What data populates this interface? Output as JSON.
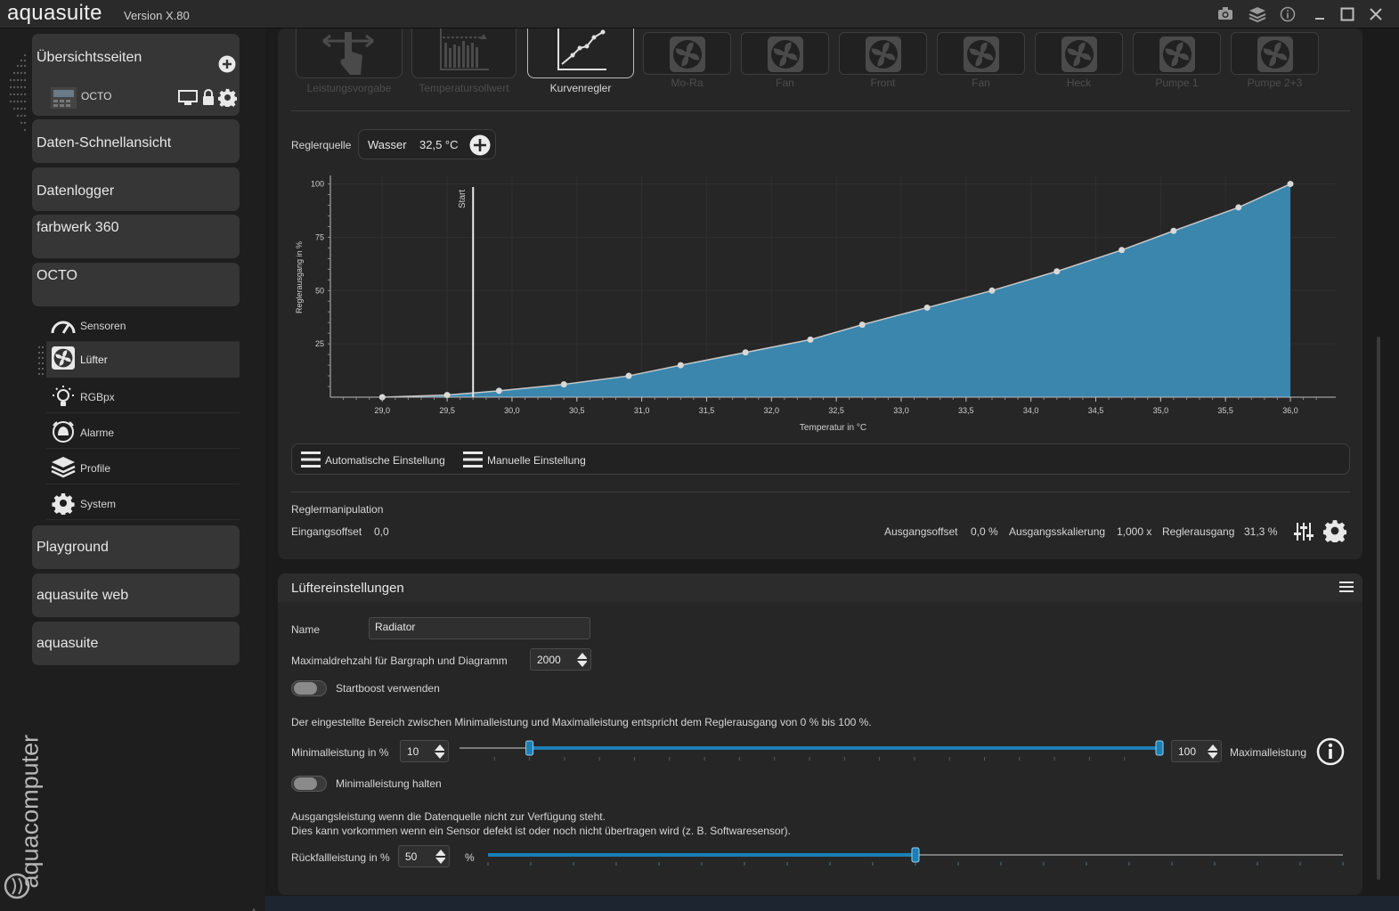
{
  "app": {
    "logo": "aquasuite",
    "version": "Version X.80",
    "vertical_brand": "aquacomputer"
  },
  "sidebar": {
    "overview": {
      "title": "Übersichtsseiten",
      "device": "OCTO"
    },
    "cards": [
      {
        "label": "Daten-Schnellansicht"
      },
      {
        "label": "Datenlogger"
      },
      {
        "label": "farbwerk 360"
      },
      {
        "label": "OCTO"
      }
    ],
    "sub_items": [
      {
        "label": "Sensoren",
        "icon": "gauge-icon"
      },
      {
        "label": "Lüfter",
        "icon": "fan-icon",
        "active": true
      },
      {
        "label": "RGBpx",
        "icon": "bulb-icon"
      },
      {
        "label": "Alarme",
        "icon": "alarm-icon"
      },
      {
        "label": "Profile",
        "icon": "layers-icon"
      },
      {
        "label": "System",
        "icon": "gear-icon"
      }
    ],
    "bottom_cards": [
      {
        "label": "Playground"
      },
      {
        "label": "aquasuite web"
      },
      {
        "label": "aquasuite"
      }
    ]
  },
  "controller": {
    "modes": [
      {
        "label": "Leistungsvorgabe",
        "state": "inactive"
      },
      {
        "label": "Temperatursollwert",
        "state": "inactive"
      },
      {
        "label": "Kurvenregler",
        "state": "active"
      }
    ],
    "fan_tiles": [
      {
        "label": "Mo-Ra"
      },
      {
        "label": "Fan"
      },
      {
        "label": "Front"
      },
      {
        "label": "Fan"
      },
      {
        "label": "Heck"
      },
      {
        "label": "Pumpe  1"
      },
      {
        "label": "Pumpe 2+3"
      }
    ],
    "source_label": "Reglerquelle",
    "source_name": "Wasser",
    "source_value": "32,5 °C",
    "auto_button": "Automatische Einstellung",
    "manual_button": "Manuelle Einstellung",
    "manipulation_label": "Reglermanipulation",
    "input_offset_label": "Eingangsoffset",
    "input_offset_value": "0,0",
    "output_offset_label": "Ausgangsoffset",
    "output_offset_value": "0,0 %",
    "output_scale_label": "Ausgangsskalierung",
    "output_scale_value": "1,000 x",
    "controller_output_label": "Reglerausgang",
    "controller_output_value": "31,3 %"
  },
  "chart_data": {
    "type": "area",
    "xlabel": "Temperatur in °C",
    "ylabel": "Reglerausgang in %",
    "xlim": [
      28.6,
      36.35
    ],
    "ylim": [
      0,
      104
    ],
    "x_ticks": [
      "29,0",
      "29,5",
      "30,0",
      "30,5",
      "31,0",
      "31,5",
      "32,0",
      "32,5",
      "33,0",
      "33,5",
      "34,0",
      "34,5",
      "35,0",
      "35,5",
      "36,0"
    ],
    "x_tick_values": [
      29.0,
      29.5,
      30.0,
      30.5,
      31.0,
      31.5,
      32.0,
      32.5,
      33.0,
      33.5,
      34.0,
      34.5,
      35.0,
      35.5,
      36.0
    ],
    "y_ticks": [
      "25",
      "50",
      "75",
      "100"
    ],
    "y_tick_values": [
      25,
      50,
      75,
      100
    ],
    "start_marker": {
      "label": "Start",
      "x": 29.7
    },
    "fill_color": "#3a86ad",
    "series": [
      {
        "x": [
          29.0,
          29.5,
          29.9,
          30.4,
          30.9,
          31.3,
          31.8,
          32.3,
          32.7,
          33.2,
          33.7,
          34.2,
          34.7,
          35.1,
          35.6,
          36.0
        ],
        "values": [
          0,
          1,
          3,
          6,
          10,
          15,
          21,
          27,
          34,
          42,
          50,
          59,
          69,
          78,
          89,
          100
        ]
      }
    ]
  },
  "fan_settings": {
    "title": "Lüftereinstellungen",
    "name_label": "Name",
    "name_value": "Radiator",
    "max_rpm_label": "Maximaldrehzahl für Bargraph und Diagramm",
    "max_rpm_value": "2000",
    "startboost_label": "Startboost verwenden",
    "range_info": "Der eingestellte Bereich zwischen Minimalleistung und Maximalleistung entspricht dem Reglerausgang von 0 % bis 100 %.",
    "min_label": "Minimalleistung in %",
    "min_value": "10",
    "max_value": "100",
    "max_label": "Maximalleistung",
    "hold_min_label": "Minimalleistung halten",
    "fallback_info_1": "Ausgangsleistung wenn die Datenquelle nicht zur Verfügung steht.",
    "fallback_info_2": "Dies kann vorkommen wenn ein Sensor defekt ist oder noch nicht übertragen wird (z. B. Softwaresensor).",
    "fallback_label": "Rückfallleistung in %",
    "fallback_value": "50",
    "fallback_unit": "%",
    "range_slider": {
      "min": 10,
      "max": 100,
      "scale_max": 100
    },
    "fallback_slider": {
      "value": 50,
      "scale_max": 100
    },
    "accent_color": "#1b7fb5"
  }
}
